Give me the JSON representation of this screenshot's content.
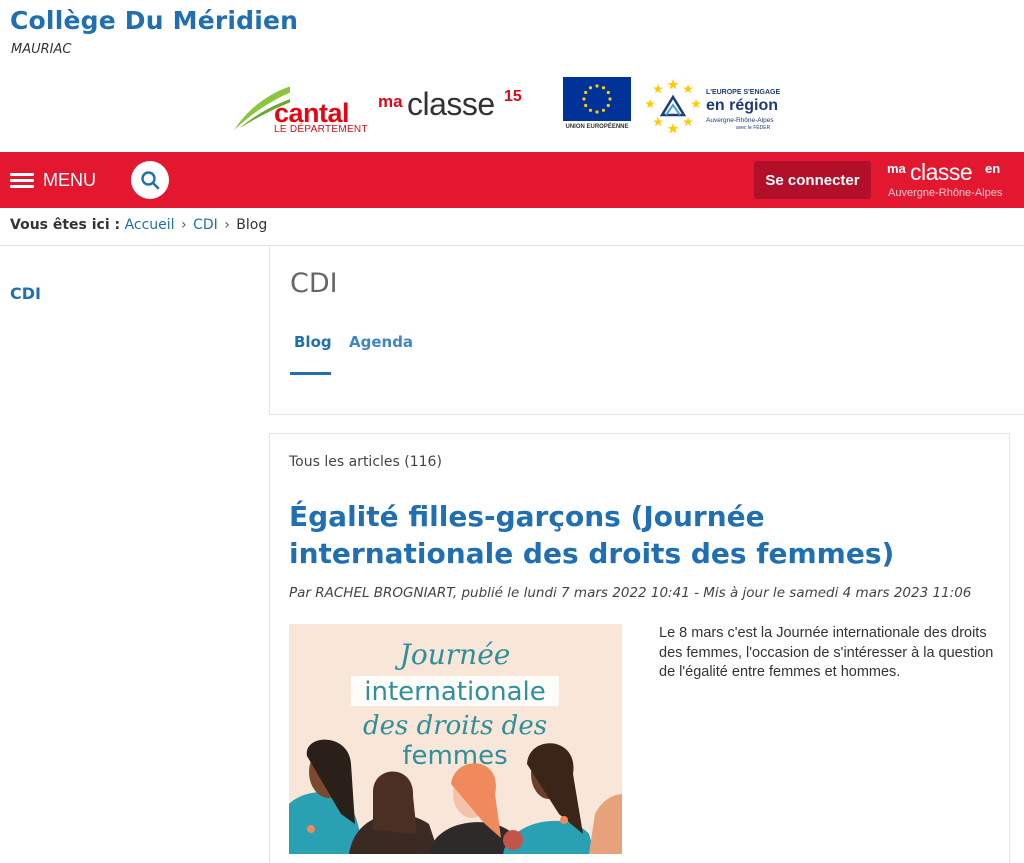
{
  "site": {
    "title": "Collège Du Méridien",
    "subtitle": "MAURIAC"
  },
  "partner_logos": {
    "cantal_word": "cantal",
    "cantal_sub": "LE DÉPARTEMENT",
    "maclasse_ma": "ma",
    "maclasse_classe": "classe",
    "maclasse_num": "15",
    "eu_text": "UNION EUROPÉENNE",
    "region_line1": "L'EUROPE S'ENGAGE",
    "region_line2": "en région",
    "region_line3": "Auvergne-Rhône-Alpes",
    "region_line4": "avec le FEDER"
  },
  "nav": {
    "menu_label": "MENU",
    "login_label": "Se connecter",
    "brand_ma": "ma",
    "brand_classe": "classe",
    "brand_en": "en",
    "brand_region": "Auvergne-Rhône-Alpes",
    "bar_color": "#e3172f"
  },
  "breadcrumb": {
    "label": "Vous êtes ici :",
    "items": [
      "Accueil",
      "CDI",
      "Blog"
    ]
  },
  "sidebar": {
    "items": [
      {
        "label": "CDI"
      }
    ]
  },
  "section": {
    "title": "CDI",
    "tabs": [
      {
        "label": "Blog",
        "active": true
      },
      {
        "label": "Agenda",
        "active": false
      }
    ]
  },
  "articles": {
    "count_label": "Tous les articles (116)",
    "items": [
      {
        "title": "Égalité filles-garçons (Journée internationale des droits des femmes)",
        "meta": "Par RACHEL BROGNIART, publié le lundi 7 mars 2022 10:41 - Mis à jour le samedi 4 mars 2023 11:06",
        "image_text": [
          "Journée",
          "internationale",
          "des droits des",
          "femmes"
        ],
        "excerpt": "Le 8 mars c'est la Journée internationale des droits des femmes, l'occasion de s'intéresser à la question de l'égalité entre femmes et hommes."
      }
    ]
  },
  "colors": {
    "link_blue": "#1f6fb2",
    "brand_red": "#e3172f",
    "button_dark_red": "#b2102a"
  }
}
